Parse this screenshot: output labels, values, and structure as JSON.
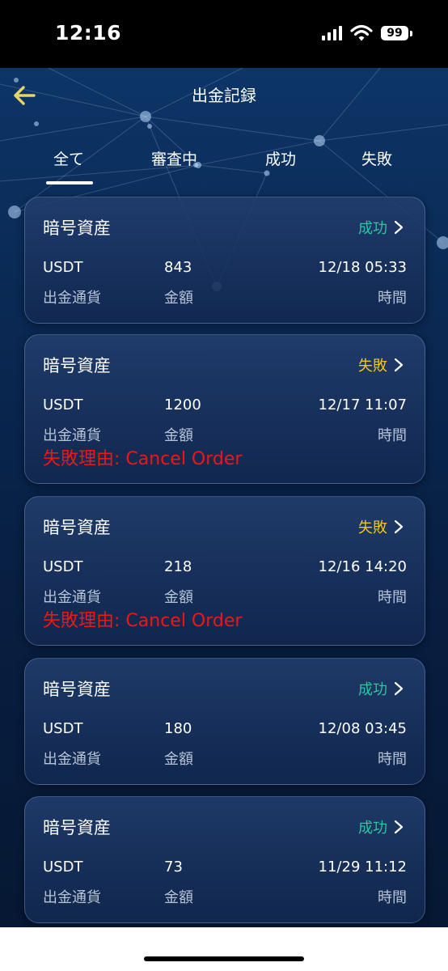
{
  "status_bar": {
    "time": "12:16",
    "battery": "99"
  },
  "header": {
    "title": "出金記録"
  },
  "tabs": [
    {
      "label": "全て",
      "active": true
    },
    {
      "label": "審査中",
      "active": false
    },
    {
      "label": "成功",
      "active": false
    },
    {
      "label": "失敗",
      "active": false
    }
  ],
  "labels": {
    "currency": "出金通貨",
    "amount": "金額",
    "time": "時間"
  },
  "records": [
    {
      "title": "暗号資産",
      "status": "成功",
      "currency": "USDT",
      "amount": "843",
      "time": "12/18 05:33",
      "reason": ""
    },
    {
      "title": "暗号資産",
      "status": "失敗",
      "currency": "USDT",
      "amount": "1200",
      "time": "12/17 11:07",
      "reason": "失敗理由: Cancel Order"
    },
    {
      "title": "暗号資産",
      "status": "失敗",
      "currency": "USDT",
      "amount": "218",
      "time": "12/16 14:20",
      "reason": "失敗理由: Cancel Order"
    },
    {
      "title": "暗号資産",
      "status": "成功",
      "currency": "USDT",
      "amount": "180",
      "time": "12/08 03:45",
      "reason": ""
    },
    {
      "title": "暗号資産",
      "status": "成功",
      "currency": "USDT",
      "amount": "73",
      "time": "11/29 11:12",
      "reason": ""
    }
  ],
  "icons": {
    "back": "arrow-left-icon",
    "chevron": "chevron-right-icon",
    "signal": "cellular-signal-icon",
    "wifi": "wifi-icon",
    "battery": "battery-icon"
  },
  "colors": {
    "success": "#2ec4a0",
    "failed": "#f5c518",
    "reason": "#f01616",
    "back_arrow": "#e6d36a",
    "background": "#0a2a55"
  }
}
